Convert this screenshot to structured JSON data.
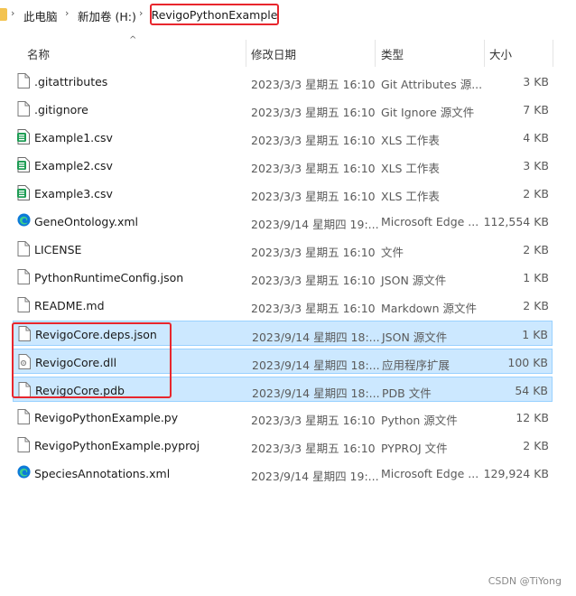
{
  "breadcrumb": {
    "items": [
      "此电脑",
      "新加卷 (H:)"
    ],
    "current": "RevigoPythonExample"
  },
  "columns": {
    "name": "名称",
    "date": "修改日期",
    "type": "类型",
    "size": "大小"
  },
  "files": [
    {
      "name": ".gitattributes",
      "date": "2023/3/3 星期五 16:10",
      "type": "Git Attributes 源...",
      "size": "3 KB",
      "icon": "document-icon",
      "selected": false
    },
    {
      "name": ".gitignore",
      "date": "2023/3/3 星期五 16:10",
      "type": "Git Ignore 源文件",
      "size": "7 KB",
      "icon": "document-icon",
      "selected": false
    },
    {
      "name": "Example1.csv",
      "date": "2023/3/3 星期五 16:10",
      "type": "XLS 工作表",
      "size": "4 KB",
      "icon": "spreadsheet-icon",
      "selected": false
    },
    {
      "name": "Example2.csv",
      "date": "2023/3/3 星期五 16:10",
      "type": "XLS 工作表",
      "size": "3 KB",
      "icon": "spreadsheet-icon",
      "selected": false
    },
    {
      "name": "Example3.csv",
      "date": "2023/3/3 星期五 16:10",
      "type": "XLS 工作表",
      "size": "2 KB",
      "icon": "spreadsheet-icon",
      "selected": false
    },
    {
      "name": "GeneOntology.xml",
      "date": "2023/9/14 星期四 19:...",
      "type": "Microsoft Edge ...",
      "size": "112,554 KB",
      "icon": "edge-icon",
      "selected": false
    },
    {
      "name": "LICENSE",
      "date": "2023/3/3 星期五 16:10",
      "type": "文件",
      "size": "2 KB",
      "icon": "document-icon",
      "selected": false
    },
    {
      "name": "PythonRuntimeConfig.json",
      "date": "2023/3/3 星期五 16:10",
      "type": "JSON 源文件",
      "size": "1 KB",
      "icon": "document-icon",
      "selected": false
    },
    {
      "name": "README.md",
      "date": "2023/3/3 星期五 16:10",
      "type": "Markdown 源文件",
      "size": "2 KB",
      "icon": "document-icon",
      "selected": false
    },
    {
      "name": "RevigoCore.deps.json",
      "date": "2023/9/14 星期四 18:...",
      "type": "JSON 源文件",
      "size": "1 KB",
      "icon": "document-icon",
      "selected": true
    },
    {
      "name": "RevigoCore.dll",
      "date": "2023/9/14 星期四 18:...",
      "type": "应用程序扩展",
      "size": "100 KB",
      "icon": "dll-icon",
      "selected": true
    },
    {
      "name": "RevigoCore.pdb",
      "date": "2023/9/14 星期四 18:...",
      "type": "PDB 文件",
      "size": "54 KB",
      "icon": "document-icon",
      "selected": true
    },
    {
      "name": "RevigoPythonExample.py",
      "date": "2023/3/3 星期五 16:10",
      "type": "Python 源文件",
      "size": "12 KB",
      "icon": "document-icon",
      "selected": false
    },
    {
      "name": "RevigoPythonExample.pyproj",
      "date": "2023/3/3 星期五 16:10",
      "type": "PYPROJ 文件",
      "size": "2 KB",
      "icon": "document-icon",
      "selected": false
    },
    {
      "name": "SpeciesAnnotations.xml",
      "date": "2023/9/14 星期四 19:...",
      "type": "Microsoft Edge ...",
      "size": "129,924 KB",
      "icon": "edge-icon",
      "selected": false
    }
  ],
  "watermark": "CSDN @TiYong",
  "colors": {
    "selection": "#cce8ff",
    "selection_border": "#99d1ff",
    "annotation_red": "#e8262d"
  }
}
